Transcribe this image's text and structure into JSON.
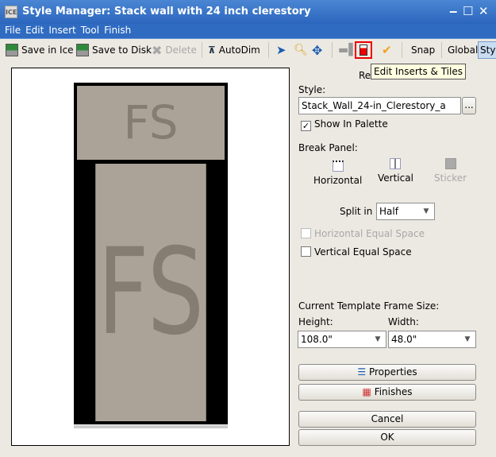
{
  "window": {
    "title": "Style Manager: Stack wall with 24 inch clerestory",
    "app_icon": "ICE"
  },
  "menu": [
    "File",
    "Edit",
    "Insert",
    "Tool",
    "Finish"
  ],
  "toolbar": {
    "save_in_ice": "Save in Ice",
    "save_to_disk": "Save to Disk",
    "delete": "Delete",
    "autodim": "AutoDim",
    "snap": "Snap",
    "global": "Global",
    "sty": "Sty"
  },
  "tooltip": "Edit Inserts & Tiles",
  "canvas": {
    "top_panel": "FS",
    "bottom_panel": "FS"
  },
  "right": {
    "re": "Re",
    "style_label": "Style:",
    "style_value": "Stack_Wall_24-in_Clerestory_a",
    "browse": "...",
    "show_in_palette": "Show In Palette",
    "show_in_palette_checked": true,
    "break_panel": "Break Panel:",
    "horizontal": "Horizontal",
    "vertical": "Vertical",
    "sticker": "Sticker",
    "split_in_label": "Split in",
    "split_in_value": "Half",
    "h_equal": "Horizontal Equal Space",
    "v_equal": "Vertical Equal Space",
    "frame_size": "Current Template Frame Size:",
    "height_label": "Height:",
    "width_label": "Width:",
    "height_value": "108.0\"",
    "width_value": "48.0\"",
    "properties": "Properties",
    "finishes": "Finishes",
    "cancel": "Cancel",
    "ok": "OK"
  }
}
